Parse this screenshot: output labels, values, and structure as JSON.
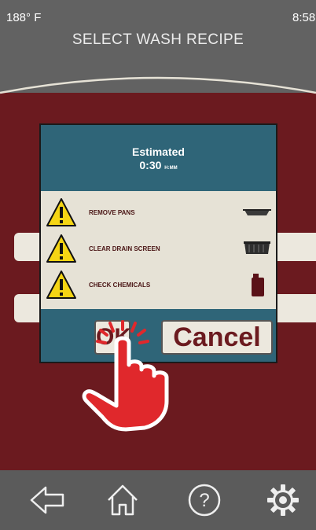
{
  "status": {
    "temperature": "188° F",
    "time": "8:58"
  },
  "header": {
    "title": "SELECT WASH RECIPE"
  },
  "modal": {
    "estimated_label": "Estimated",
    "estimated_time": "0:30",
    "estimated_unit": "H:MM",
    "checklist": [
      {
        "label": "REMOVE PANS",
        "icon": "pan-icon"
      },
      {
        "label": "CLEAR DRAIN SCREEN",
        "icon": "drain-screen-icon"
      },
      {
        "label": "CHECK CHEMICALS",
        "icon": "chemical-jug-icon"
      }
    ],
    "ok_label": "OK",
    "cancel_label": "Cancel"
  },
  "nav": {
    "items": [
      {
        "icon": "back-arrow-icon"
      },
      {
        "icon": "home-icon"
      },
      {
        "icon": "help-icon"
      },
      {
        "icon": "settings-gear-icon"
      }
    ]
  },
  "colors": {
    "header_bg": "#626262",
    "panel_red": "#6b1a1f",
    "modal_teal": "#2f6578",
    "cream": "#e6e2d6",
    "warning_yellow": "#f5d514",
    "touch_red": "#e0282c"
  }
}
